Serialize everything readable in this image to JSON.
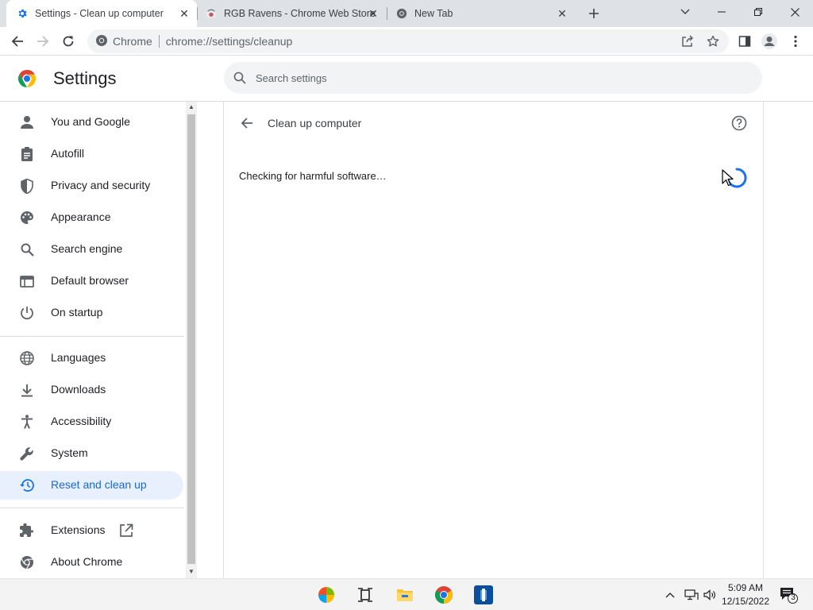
{
  "tabs": [
    {
      "title": "Settings - Clean up computer",
      "favicon": "gear-icon",
      "active": true
    },
    {
      "title": "RGB Ravens - Chrome Web Store",
      "favicon": "chrome-web-store-icon",
      "active": false
    },
    {
      "title": "New Tab",
      "favicon": "chrome-icon",
      "active": false
    }
  ],
  "omnibox": {
    "site_chip": "Chrome",
    "url_scheme": "chrome://",
    "url_rest": "settings/cleanup"
  },
  "header": {
    "title": "Settings",
    "search_placeholder": "Search settings"
  },
  "sidebar": {
    "items": [
      {
        "label": "You and Google",
        "icon": "person-icon"
      },
      {
        "label": "Autofill",
        "icon": "clipboard-icon"
      },
      {
        "label": "Privacy and security",
        "icon": "shield-icon"
      },
      {
        "label": "Appearance",
        "icon": "palette-icon"
      },
      {
        "label": "Search engine",
        "icon": "search-icon"
      },
      {
        "label": "Default browser",
        "icon": "browser-window-icon"
      },
      {
        "label": "On startup",
        "icon": "power-icon"
      },
      {
        "label": "Languages",
        "icon": "globe-icon"
      },
      {
        "label": "Downloads",
        "icon": "download-icon"
      },
      {
        "label": "Accessibility",
        "icon": "accessibility-icon"
      },
      {
        "label": "System",
        "icon": "wrench-icon"
      },
      {
        "label": "Reset and clean up",
        "icon": "restore-icon",
        "selected": true
      },
      {
        "label": "Extensions",
        "icon": "puzzle-icon"
      },
      {
        "label": "About Chrome",
        "icon": "chrome-icon"
      }
    ]
  },
  "main": {
    "page_title": "Clean up computer",
    "status": "Checking for harmful software…"
  },
  "taskbar": {
    "time": "5:09 AM",
    "date": "12/15/2022",
    "notification_count": "3"
  },
  "colors": {
    "accent": "#1a73e8",
    "selected_bg": "#e8f0fe",
    "tabstrip_bg": "#dee1e6"
  }
}
